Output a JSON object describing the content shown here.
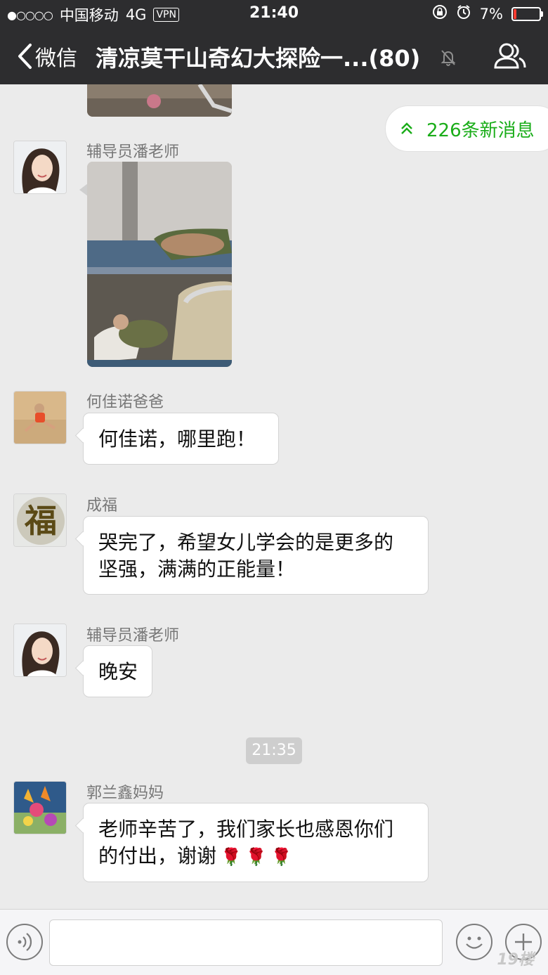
{
  "status_bar": {
    "signal_dots": "●○○○○",
    "carrier": "中国移动",
    "network": "4G",
    "vpn": "VPN",
    "time": "21:40",
    "battery": "7%"
  },
  "nav": {
    "back_label": "微信",
    "title": "清凉莫干山奇幻大探险一...(80)"
  },
  "new_messages": "226条新消息",
  "messages": [
    {
      "sender": "辅导员潘老师",
      "type": "image"
    },
    {
      "sender": "何佳诺爸爸",
      "text": "何佳诺，哪里跑！"
    },
    {
      "sender": "成福",
      "line1": "哭完了，希望女儿学会的是更多的",
      "line2": "坚强，满满的正能量！"
    },
    {
      "sender": "辅导员潘老师",
      "text": "晚安"
    },
    {
      "sender": "郭兰鑫妈妈",
      "line1": "老师辛苦了，我们家长也感恩你们",
      "line2": "的付出，谢谢"
    }
  ],
  "time_divider": "21:35",
  "avatar_text": {
    "chengfu": "福"
  },
  "watermark": "19楼",
  "colors": {
    "nav_bg": "#2d2d2f",
    "chat_bg": "#ebebeb",
    "accent_green": "#1aad19",
    "battery_low": "#ff3b30"
  }
}
